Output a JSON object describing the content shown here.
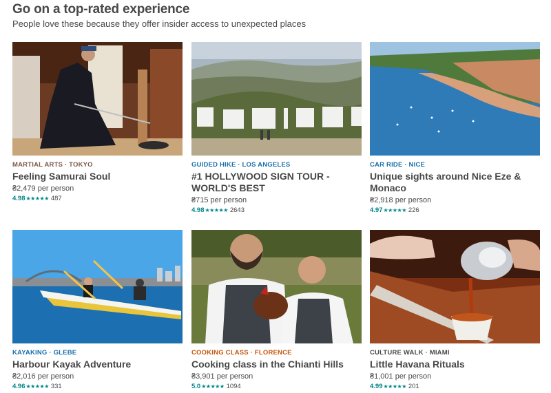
{
  "section": {
    "title": "Go on a top-rated experience",
    "subtitle": "People love these because they offer insider access to unexpected places"
  },
  "colors": {
    "text": "#484848",
    "rating_teal": "#008489",
    "kicker_brown": "#914669",
    "kicker_blue": "#1a6fa9",
    "kicker_orange": "#c4560c"
  },
  "experiences": [
    {
      "kicker": "MARTIAL ARTS · TOKYO",
      "kicker_color": "#7d5a47",
      "title": "Feeling Samurai Soul",
      "price": "₴2,479 per person",
      "rating": "4.98",
      "stars": "★★★★★",
      "reviews": "487",
      "image": "samurai-photo"
    },
    {
      "kicker": "GUIDED HIKE · LOS ANGELES",
      "kicker_color": "#1a6fa9",
      "title": "#1 HOLLYWOOD SIGN TOUR - WORLD'S BEST",
      "price": "₴715 per person",
      "rating": "4.98",
      "stars": "★★★★★",
      "reviews": "2643",
      "image": "hollywood-sign-photo"
    },
    {
      "kicker": "CAR RIDE · NICE",
      "kicker_color": "#1a6fa9",
      "title": "Unique sights around Nice Eze & Monaco",
      "price": "₴2,918 per person",
      "rating": "4.97",
      "stars": "★★★★★",
      "reviews": "226",
      "image": "nice-coast-photo"
    },
    {
      "kicker": "KAYAKING · GLEBE",
      "kicker_color": "#1a6fa9",
      "title": "Harbour Kayak Adventure",
      "price": "₴2,016 per person",
      "rating": "4.96",
      "stars": "★★★★★",
      "reviews": "331",
      "image": "kayak-photo"
    },
    {
      "kicker": "COOKING CLASS · FLORENCE",
      "kicker_color": "#c4560c",
      "title": "Cooking class in the Chianti Hills",
      "price": "₴3,901 per person",
      "rating": "5.0",
      "stars": "★★★★★",
      "reviews": "1094",
      "image": "chefs-photo"
    },
    {
      "kicker": "CULTURE WALK · MIAMI",
      "kicker_color": "#484848",
      "title": "Little Havana Rituals",
      "price": "₴1,001 per person",
      "rating": "4.99",
      "stars": "★★★★★",
      "reviews": "201",
      "image": "coffee-photo"
    }
  ]
}
